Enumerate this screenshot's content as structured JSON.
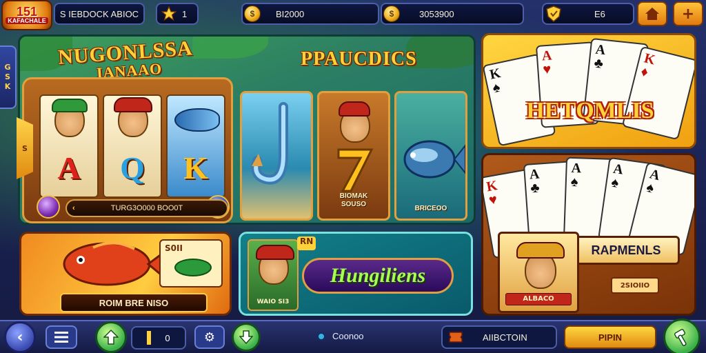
{
  "logo": {
    "line1": "151",
    "line2": "KAFACHALE"
  },
  "top": {
    "player_label": "S IEBDOCK ABIOC",
    "level": "1",
    "coins": "BI2000",
    "gems": "3053900",
    "notif": "E6",
    "star_icon": "star-icon",
    "plus_label": "+"
  },
  "side": {
    "tab_text": [
      "G",
      "S",
      "K"
    ],
    "arrow_text": "S"
  },
  "slot1": {
    "title_line1": "NUGONLSSA",
    "title_line2": "IANAAO",
    "reels": [
      {
        "letter": "A",
        "figure": "green-hat-face"
      },
      {
        "letter": "Q",
        "figure": "red-hat-face"
      },
      {
        "letter": "K",
        "figure": "blue-fish"
      }
    ],
    "bar_chevron": "‹",
    "bar_text": "TURG3O000 BOO0T"
  },
  "slot2": {
    "title": "PPAUCDICS",
    "cards": [
      {
        "caption": ""
      },
      {
        "caption": "BIOMAK\nSOUSO"
      },
      {
        "caption": "BRICEOO"
      }
    ]
  },
  "tile_fish": {
    "badge": "S0II",
    "label": "ROIM BRE NISO"
  },
  "tile_jungle": {
    "chip": "RN",
    "caption": "WAIO SI3",
    "logo": "Hungiliens"
  },
  "cards_top": {
    "logo": "HETQMLIS",
    "cards": [
      "K",
      "A",
      "A",
      "K"
    ]
  },
  "cards_bot": {
    "cards": [
      "K",
      "A",
      "A",
      "A",
      "A"
    ],
    "banner": "RAPMENLS",
    "tag": "2SIOIIO",
    "portrait_caption": "ALBACO"
  },
  "bottom": {
    "level_value": "0",
    "status_text": "Coonoo",
    "currency_label": "AIIBCTOIN",
    "play_label": "PIPIN"
  },
  "colors": {
    "accent": "#ffd23a",
    "bg": "#1a1f4a",
    "green": "#3ab04a"
  }
}
